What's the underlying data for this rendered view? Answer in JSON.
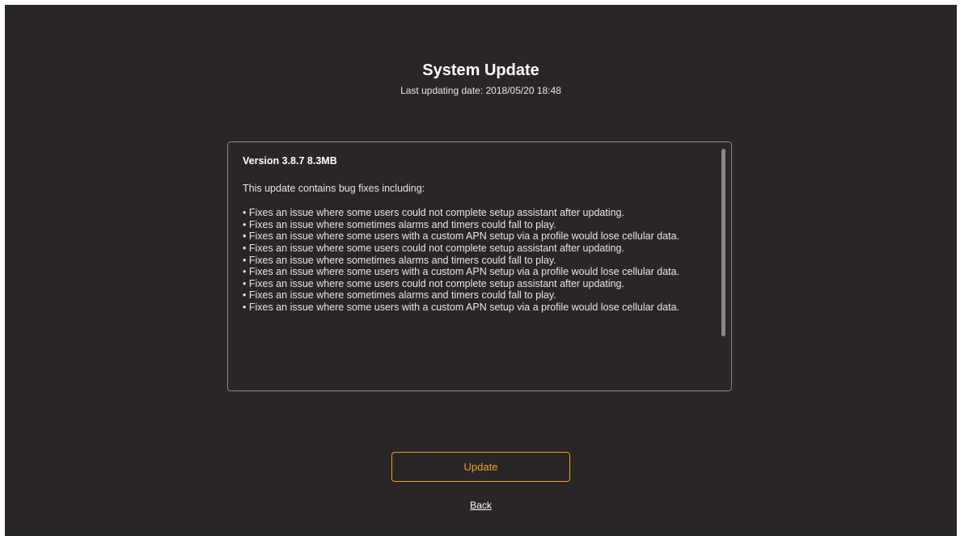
{
  "header": {
    "title": "System Update",
    "last_update": "Last updating date: 2018/05/20 18:48"
  },
  "release_notes": {
    "version": "Version 3.8.7  8.3MB",
    "intro": "This update contains bug fixes including:",
    "items": [
      "• Fixes an issue where some users could not complete setup assistant after updating.",
      "• Fixes an issue where sometimes alarms and timers could fall to play.",
      "• Fixes an issue where some users with a custom APN setup via a profile would lose cellular data.",
      "• Fixes an issue where some users could not complete setup assistant after updating.",
      "• Fixes an issue where sometimes alarms and timers could fall to play.",
      "• Fixes an issue where some users with a custom APN setup via a profile would lose cellular data.",
      "• Fixes an issue where some users could not complete setup assistant after updating.",
      "• Fixes an issue where sometimes alarms and timers could fall to play.",
      "• Fixes an issue where some users with a custom APN setup via a profile would lose cellular data."
    ]
  },
  "actions": {
    "update_label": "Update",
    "back_label": "Back"
  },
  "colors": {
    "background": "#2a2627",
    "accent": "#e8a31d",
    "box_border": "#8a8485",
    "scrollbar": "#8e8485"
  }
}
